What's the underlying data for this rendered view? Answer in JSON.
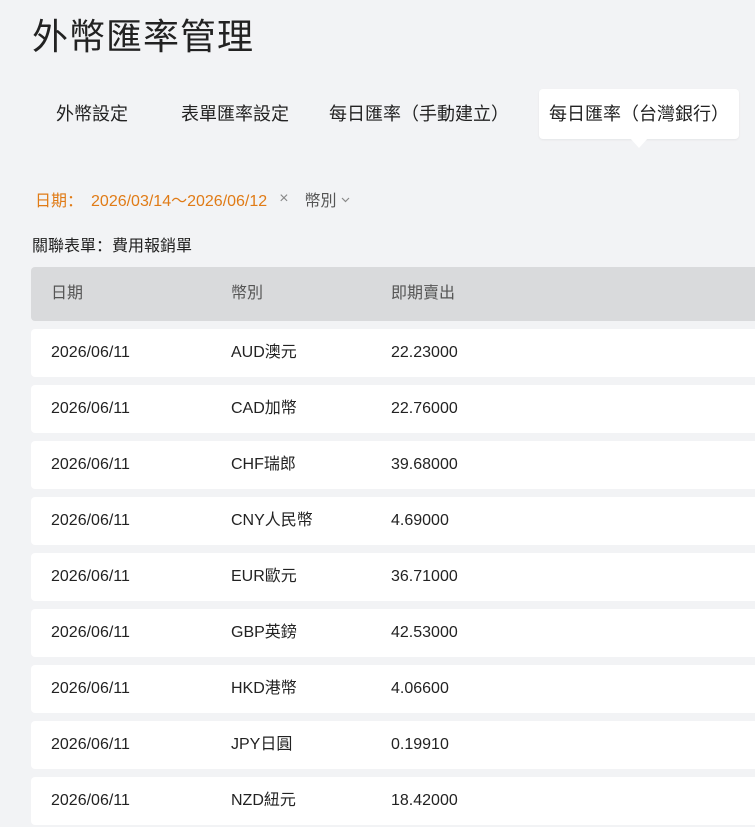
{
  "page": {
    "title": "外幣匯率管理"
  },
  "tabs": [
    {
      "label": "外幣設定",
      "active": false
    },
    {
      "label": "表單匯率設定",
      "active": false
    },
    {
      "label": "每日匯率（手動建立）",
      "active": false
    },
    {
      "label": "每日匯率（台灣銀行）",
      "active": true
    }
  ],
  "filters": {
    "date_label": "日期：",
    "date_range": "2026/03/14〜2026/06/12",
    "clear_icon": "×",
    "currency_label": "幣別",
    "chevron_icon": "chevron-down-icon"
  },
  "related_form": "關聯表單：費用報銷單",
  "colors": {
    "accent": "#e07b16",
    "header_bg": "#d9dadc",
    "page_bg": "#f2f3f5"
  },
  "table": {
    "headers": [
      "日期",
      "幣別",
      "即期賣出"
    ],
    "rows": [
      {
        "date": "2026/06/11",
        "currency": "AUD澳元",
        "rate": "22.23000"
      },
      {
        "date": "2026/06/11",
        "currency": "CAD加幣",
        "rate": "22.76000"
      },
      {
        "date": "2026/06/11",
        "currency": "CHF瑞郎",
        "rate": "39.68000"
      },
      {
        "date": "2026/06/11",
        "currency": "CNY人民幣",
        "rate": "4.69000"
      },
      {
        "date": "2026/06/11",
        "currency": "EUR歐元",
        "rate": "36.71000"
      },
      {
        "date": "2026/06/11",
        "currency": "GBP英鎊",
        "rate": "42.53000"
      },
      {
        "date": "2026/06/11",
        "currency": "HKD港幣",
        "rate": "4.06600"
      },
      {
        "date": "2026/06/11",
        "currency": "JPY日圓",
        "rate": "0.19910"
      },
      {
        "date": "2026/06/11",
        "currency": "NZD紐元",
        "rate": "18.42000"
      }
    ]
  }
}
